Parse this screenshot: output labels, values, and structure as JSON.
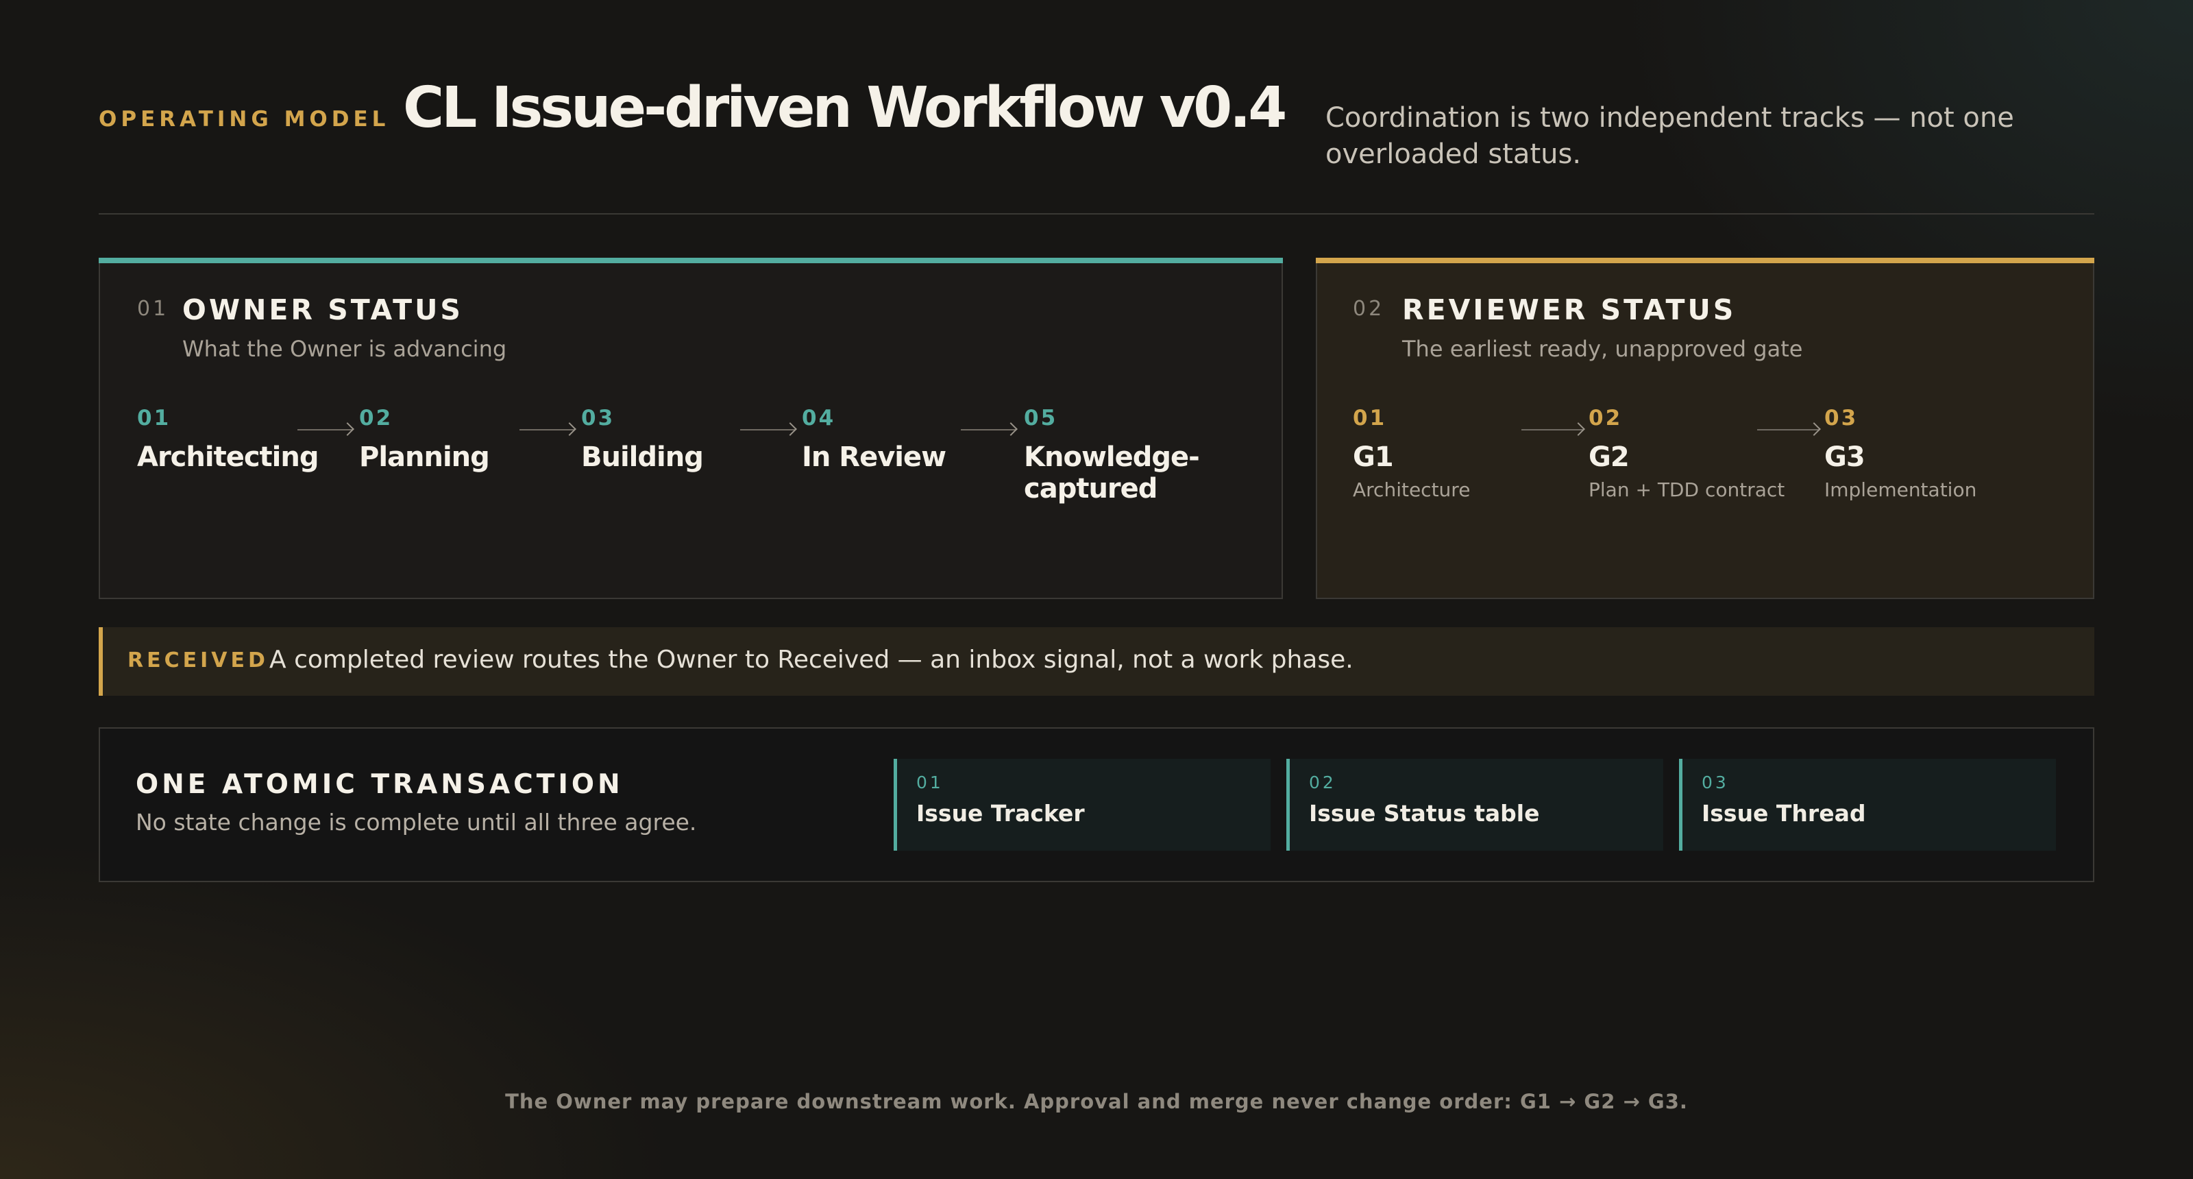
{
  "header": {
    "eyebrow": "OPERATING MODEL",
    "title": "CL Issue-driven Workflow v0.4",
    "subtitle": "Coordination is two independent tracks — not one overloaded status."
  },
  "owner": {
    "num": "01",
    "title": "OWNER STATUS",
    "subtitle": "What the Owner is advancing",
    "accent": "#53ada0",
    "steps": [
      {
        "num": "01",
        "label": "Architecting"
      },
      {
        "num": "02",
        "label": "Planning"
      },
      {
        "num": "03",
        "label": "Building"
      },
      {
        "num": "04",
        "label": "In Review"
      },
      {
        "num": "05",
        "label": "Knowledge-captured"
      }
    ]
  },
  "reviewer": {
    "num": "02",
    "title": "REVIEWER STATUS",
    "subtitle": "The earliest ready, unapproved gate",
    "accent": "#d3a54c",
    "steps": [
      {
        "num": "01",
        "label": "G1",
        "desc": "Architecture"
      },
      {
        "num": "02",
        "label": "G2",
        "desc": "Plan + TDD contract"
      },
      {
        "num": "03",
        "label": "G3",
        "desc": "Implementation"
      }
    ]
  },
  "received": {
    "label": "RECEIVED",
    "text": "A completed review routes the Owner to Received — an inbox signal, not a work phase."
  },
  "atomic": {
    "title": "ONE ATOMIC TRANSACTION",
    "subtitle": "No state change is complete until all three agree.",
    "items": [
      {
        "num": "01",
        "label": "Issue Tracker"
      },
      {
        "num": "02",
        "label": "Issue Status table"
      },
      {
        "num": "03",
        "label": "Issue Thread"
      }
    ]
  },
  "footer": "The Owner may prepare downstream work. Approval and merge never change order: G1 → G2 → G3."
}
